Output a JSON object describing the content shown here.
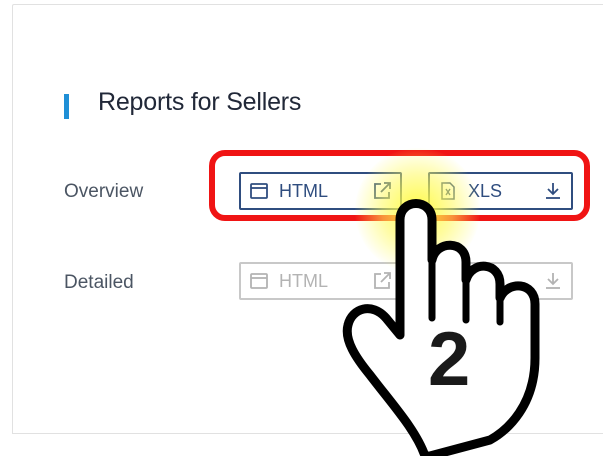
{
  "section": {
    "title": "Reports for Sellers"
  },
  "rows": [
    {
      "label": "Overview",
      "html_button": {
        "label": "HTML",
        "enabled": true
      },
      "xls_button": {
        "label": "XLS",
        "enabled": true
      }
    },
    {
      "label": "Detailed",
      "html_button": {
        "label": "HTML",
        "enabled": false
      },
      "xls_button": {
        "label": "",
        "enabled": false
      }
    }
  ],
  "annotation": {
    "step_number": "2"
  },
  "colors": {
    "accent": "#1f8fd6",
    "button_border": "#2f4d7f",
    "disabled": "#c8c8c8",
    "highlight": "#f01414",
    "glow": "#fff83c"
  },
  "icons": [
    "window-icon",
    "external-link-icon",
    "xls-file-icon",
    "download-icon",
    "pointing-hand-icon"
  ]
}
